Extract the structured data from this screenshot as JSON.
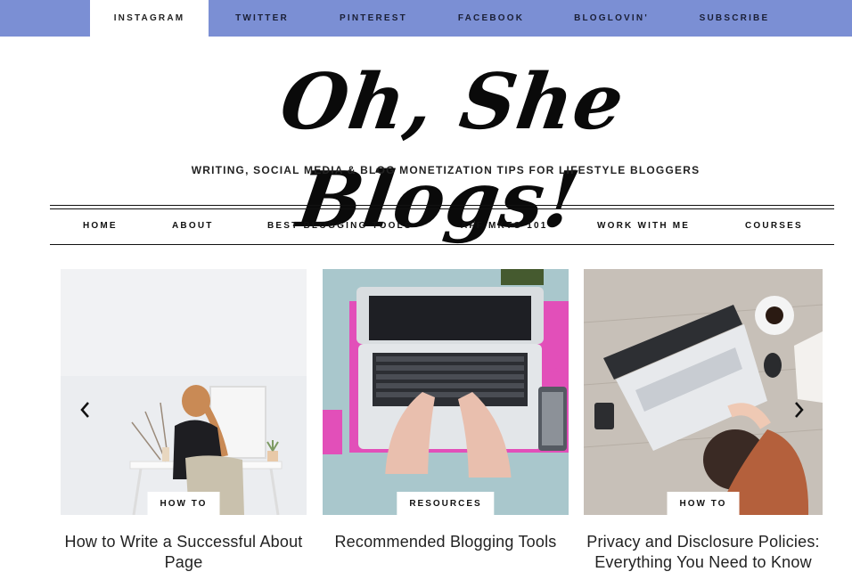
{
  "topbar": {
    "items": [
      {
        "label": "INSTAGRAM",
        "active": true
      },
      {
        "label": "TWITTER"
      },
      {
        "label": "PINTEREST"
      },
      {
        "label": "FACEBOOK"
      },
      {
        "label": "BLOGLOVIN'"
      },
      {
        "label": "SUBSCRIBE"
      }
    ],
    "bar_color": "#7b8fd4"
  },
  "logo": {
    "title": "Oh, She Blogs!",
    "tagline": "WRITING, SOCIAL MEDIA & BLOG MONETIZATION TIPS FOR LIFESTYLE BLOGGERS"
  },
  "nav": {
    "items": [
      {
        "label": "HOME"
      },
      {
        "label": "ABOUT"
      },
      {
        "label": "BEST BLOGGING TOOLS"
      },
      {
        "label": "AFF MKTG 101"
      },
      {
        "label": "WORK WITH ME"
      },
      {
        "label": "COURSES"
      }
    ]
  },
  "slider": {
    "prev_icon": "chevron-left-icon",
    "next_icon": "chevron-right-icon",
    "posts": [
      {
        "category": "HOW TO",
        "title": "How to Write a Successful About Page"
      },
      {
        "category": "RESOURCES",
        "title": "Recommended Blogging Tools"
      },
      {
        "category": "HOW TO",
        "title": "Privacy and Disclosure Policies: Everything You Need to Know"
      }
    ]
  }
}
